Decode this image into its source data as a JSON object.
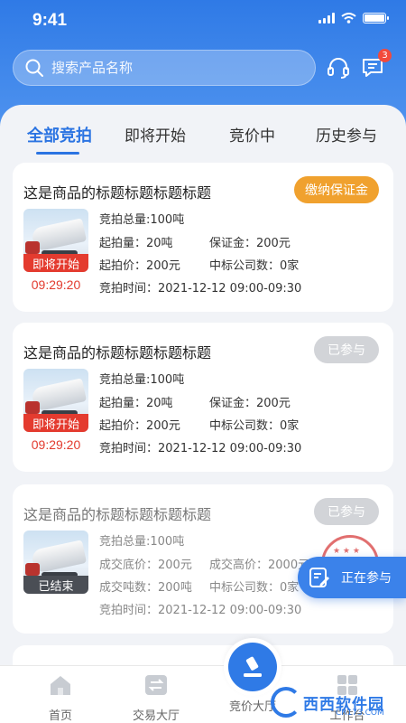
{
  "status_bar": {
    "time": "9:41"
  },
  "header": {
    "search_placeholder": "搜索产品名称",
    "message_badge": "3"
  },
  "tabs": [
    {
      "label": "全部竞拍",
      "active": true
    },
    {
      "label": "即将开始",
      "active": false
    },
    {
      "label": "竞价中",
      "active": false
    },
    {
      "label": "历史参与",
      "active": false
    }
  ],
  "cards": [
    {
      "title": "这是商品的标题标题标题标题",
      "action": "缴纳保证金",
      "status_tag": "即将开始",
      "countdown": "09:29:20",
      "lines": [
        [
          "竞拍总量:100吨",
          ""
        ],
        [
          "起拍量：20吨",
          "保证金：200元"
        ],
        [
          "起拍价：200元",
          "中标公司数：0家"
        ],
        [
          "竞拍时间：2021-12-12 09:00-09:30",
          ""
        ]
      ]
    },
    {
      "title": "这是商品的标题标题标题标题",
      "action": "已参与",
      "status_tag": "即将开始",
      "countdown": "09:29:20",
      "lines": [
        [
          "竞拍总量:100吨",
          ""
        ],
        [
          "起拍量：20吨",
          "保证金：200元"
        ],
        [
          "起拍价：200元",
          "中标公司数：0家"
        ],
        [
          "竞拍时间：2021-12-12 09:00-09:30",
          ""
        ]
      ]
    },
    {
      "title": "这是商品的标题标题标题标题",
      "action": "已参与",
      "status_tag": "已结束",
      "lines": [
        [
          "竞拍总量:100吨",
          ""
        ],
        [
          "成交底价：200元",
          "成交高价：2000元"
        ],
        [
          "成交吨数：200吨",
          "中标公司数：0家"
        ],
        [
          "竞拍时间：2021-12-12 09:00-09:30",
          ""
        ]
      ]
    }
  ],
  "floating_button": {
    "label": "正在参与"
  },
  "tabbar": {
    "items": [
      "首页",
      "交易大厅",
      "竞价大厅",
      "工作台"
    ]
  },
  "watermark": {
    "name": "西西软件园",
    "domain": "CR173.COM"
  },
  "colors": {
    "primary": "#2f7ae6",
    "orange": "#f0a12e",
    "red": "#e43b2f",
    "gray_pill": "#d2d4d8"
  }
}
